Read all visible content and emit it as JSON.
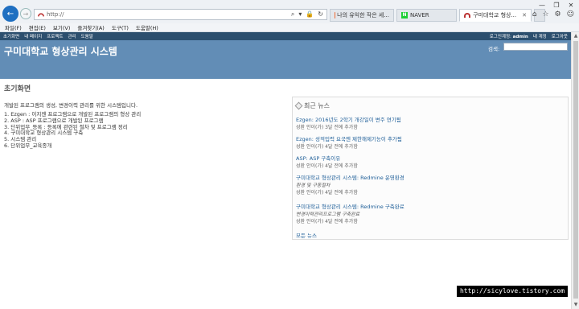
{
  "browser": {
    "url": "http://",
    "tabs": [
      {
        "label": "나의 유익한 작은 세..."
      },
      {
        "label": "NAVER"
      },
      {
        "label": "구미대학교 형상..."
      }
    ],
    "menu": [
      "파일(F)",
      "편집(E)",
      "보기(V)",
      "즐겨찾기(A)",
      "도구(T)",
      "도움말(H)"
    ]
  },
  "topmenu": {
    "left": [
      "초기화면",
      "내 페이지",
      "프로젝트",
      "관리",
      "도움말"
    ],
    "login_label": "로그인계정:",
    "login_user": "admin",
    "right": [
      "내 계정",
      "로그아웃"
    ]
  },
  "header": {
    "title": "구미대학교 형상관리 시스템",
    "search_label": "검색:",
    "search_value": ""
  },
  "main": {
    "title": "초기화면",
    "intro": "개발된 프로그램의 생성, 변경이력 관리를 위한 시스템입니다.",
    "items": [
      "1. Ezgen : 이지젠 프로그램으로 개발된 프로그램의 형상 관리",
      "2. ASP : ASP 프로그램으로 개발된 프로그램",
      "3. 단위업무_등록 : 등록에 관련된 절차 및 프로그램 정리",
      "4. 구미대학교 형상관리 시스템 구축",
      "5. 시스템 관리",
      "6. 단위업무_교육종개"
    ]
  },
  "news": {
    "title": "최근 뉴스",
    "items": [
      {
        "title": "Ezgen: 2016년도 2학기 개강일이 변주 연기됨",
        "sub": "",
        "meta": "성환 안이(가) 3달 전에 추가함"
      },
      {
        "title": "Ezgen: 성적입력 요국엔 제한해제기능이 추가됨",
        "sub": "",
        "meta": "성환 안이(가) 4달 전에 추가함"
      },
      {
        "title": "ASP: ASP 구축이유",
        "sub": "",
        "meta": "성환 안이(가) 4달 전에 추가함"
      },
      {
        "title": "구미대학교 형상관리 시스템: Redmine 운영환경",
        "sub": "환경 및 구동절차",
        "meta": "성환 안이(가) 4달 전에 추가함"
      },
      {
        "title": "구미대학교 형상관리 시스템: Redmine 구축완료",
        "sub": "변경이력관리프로그램 구축완료",
        "meta": "성환 안이(가) 4달 전에 추가함"
      }
    ],
    "all_link": "모든 뉴스"
  },
  "watermark": "http://sicylove.tistory.com"
}
